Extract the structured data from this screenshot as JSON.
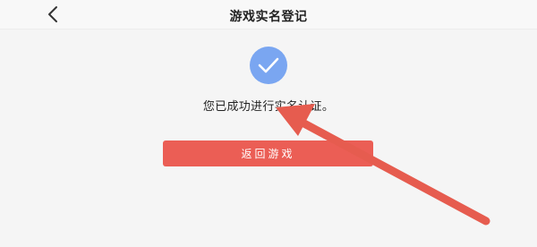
{
  "header": {
    "title": "游戏实名登记",
    "back_icon": "chevron-left-icon"
  },
  "main": {
    "status_icon": "check-circle-icon",
    "message": "您已成功进行实名认证。",
    "return_button_label": "返回游戏"
  },
  "colors": {
    "accent_blue": "#7aa6f1",
    "button_red": "#eb5e55",
    "arrow_red": "#e65c4f"
  }
}
